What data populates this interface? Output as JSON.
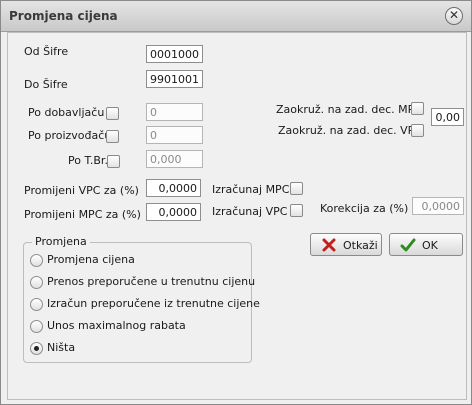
{
  "window": {
    "title": "Promjena cijena",
    "close_glyph": "✕"
  },
  "fields": {
    "od_sifre": {
      "label": "Od Šifre",
      "value": "0001000"
    },
    "do_sifre": {
      "label": "Do Šifre",
      "value": "9901001"
    },
    "po_dobavljacu": {
      "label": "Po dobavljaču",
      "value": "0"
    },
    "po_proizvodjacu": {
      "label": "Po proizvođaču",
      "value": "0"
    },
    "po_tbr": {
      "label": "Po T.Br.",
      "value": "0,000"
    },
    "zaokruz_mpc": {
      "label": "Zaokruž. na zad. dec. MPC"
    },
    "zaokruz_vpc": {
      "label": "Zaokruž. na zad. dec. VPC"
    },
    "zaokruz_value": "0,00",
    "promijeni_vpc": {
      "label": "Promijeni VPC za (%)",
      "value": "0,0000"
    },
    "promijeni_mpc": {
      "label": "Promijeni MPC za (%)",
      "value": "0,0000"
    },
    "izracunaj_mpc": {
      "label": "Izračunaj MPC"
    },
    "izracunaj_vpc": {
      "label": "Izračunaj VPC"
    },
    "korekcija": {
      "label": "Korekcija za (%)",
      "value": "0,0000"
    }
  },
  "promjena": {
    "legend": "Promjena",
    "options": [
      {
        "label": "Promjena cijena",
        "selected": false
      },
      {
        "label": "Prenos preporučene u trenutnu cijenu",
        "selected": false
      },
      {
        "label": "Izračun preporučene iz trenutne cijene",
        "selected": false
      },
      {
        "label": "Unos maximalnog rabata",
        "selected": false
      },
      {
        "label": "Ništa",
        "selected": true
      }
    ]
  },
  "buttons": {
    "cancel": {
      "label": "Otkaži",
      "icon": "x-icon",
      "color": "#c0201a"
    },
    "ok": {
      "label": "OK",
      "icon": "check-icon",
      "color": "#2e8b1e"
    }
  }
}
